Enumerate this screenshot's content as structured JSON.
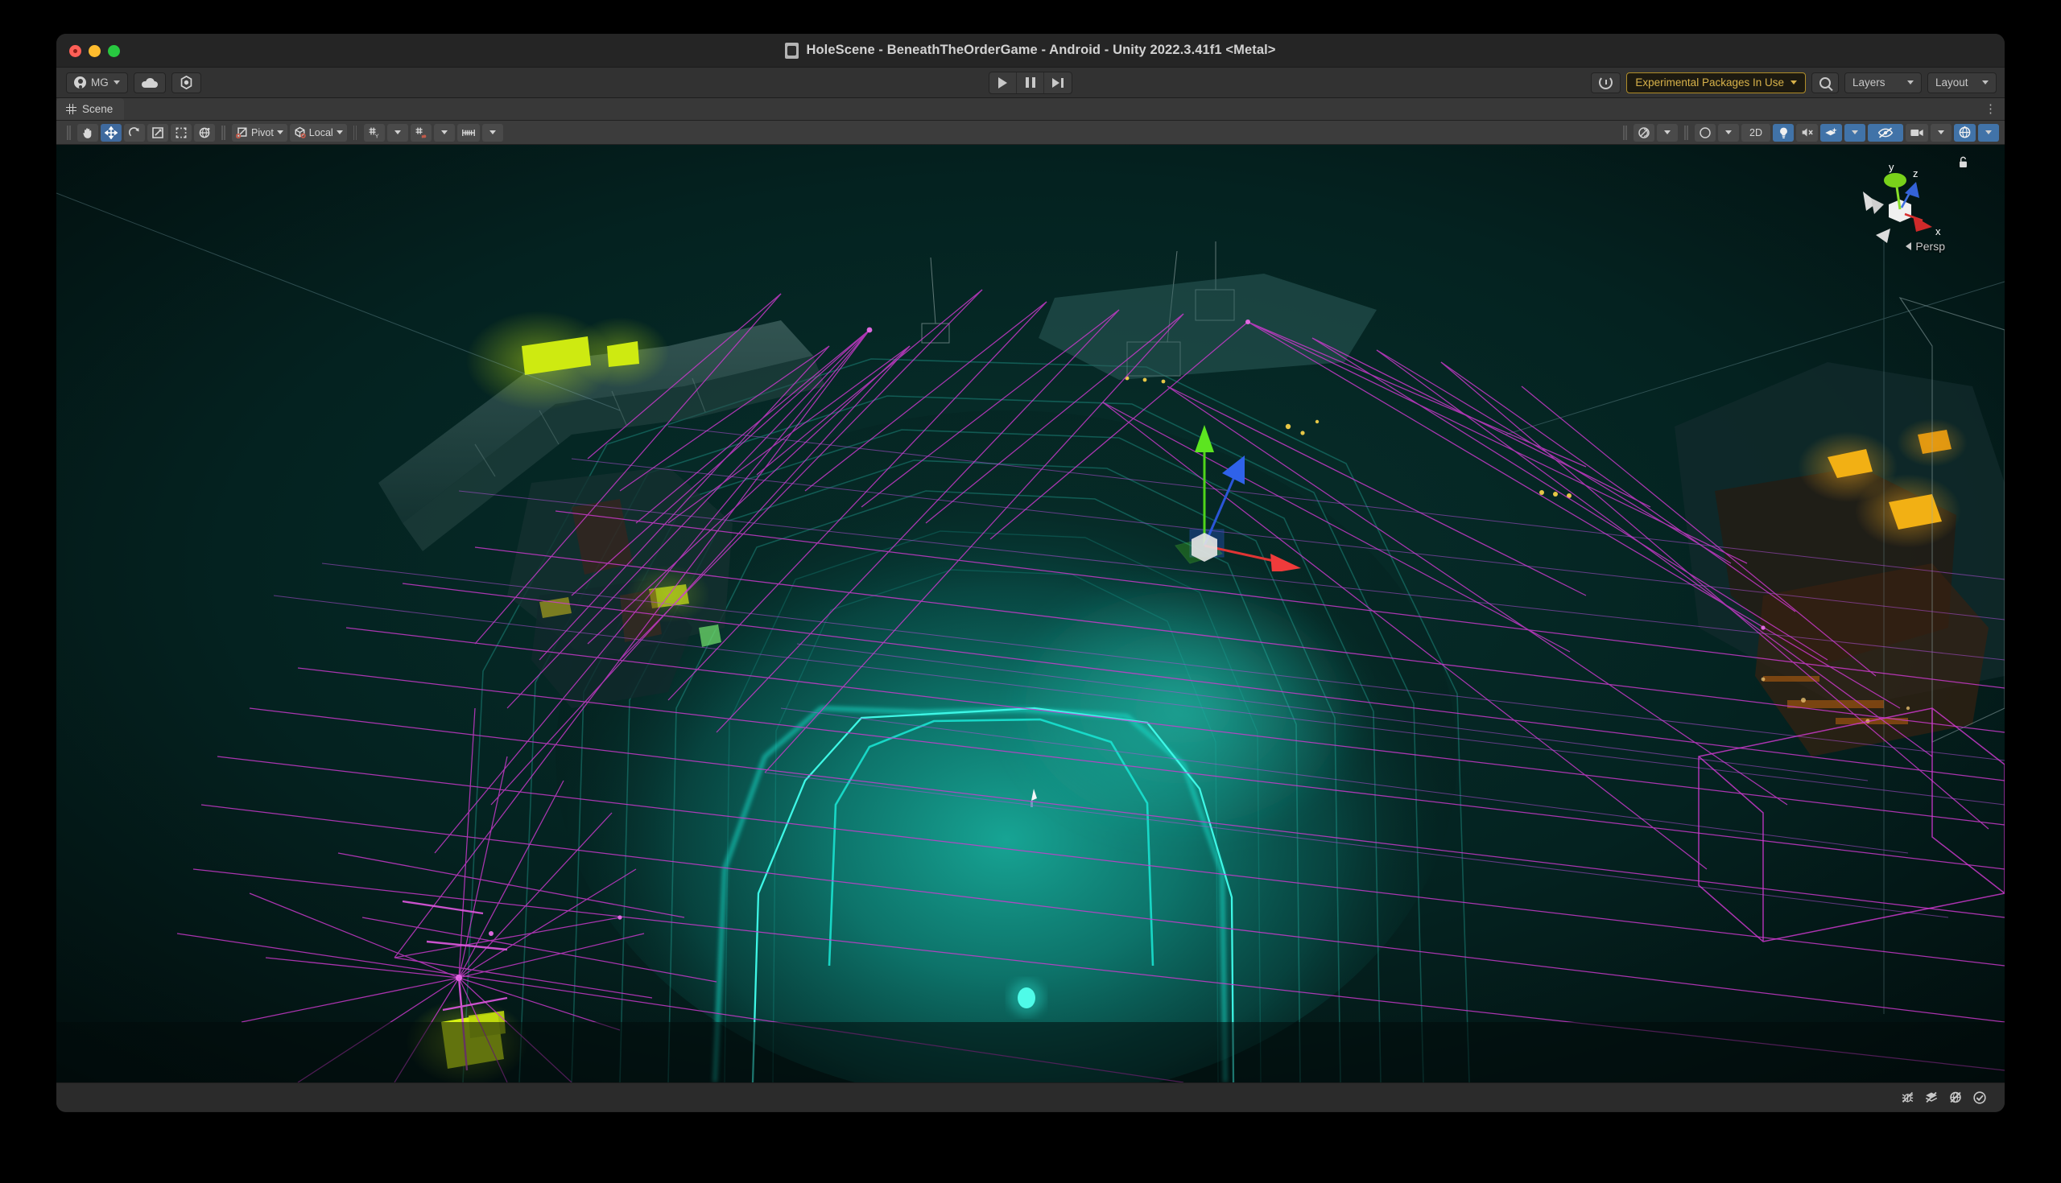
{
  "window": {
    "title": "HoleScene - BeneathTheOrderGame - Android - Unity 2022.3.41f1 <Metal>",
    "title_icon": "unity-scene-file-icon",
    "traffic_lights": [
      "close-button",
      "minimize-button",
      "zoom-button"
    ]
  },
  "main_toolbar": {
    "account_label": "MG",
    "account_icon": "account-icon",
    "cloud_icon": "cloud-icon",
    "settings_icon": "unity-services-gear-icon",
    "play_label": "play-icon",
    "pause_label": "pause-icon",
    "step_label": "step-icon",
    "history_icon": "undo-history-icon",
    "experimental_badge": "Experimental Packages In Use",
    "search_icon": "search-icon",
    "layers_label": "Layers",
    "layout_label": "Layout"
  },
  "tabs": [
    {
      "label": "Scene",
      "icon": "scene-grid-icon",
      "active": true
    }
  ],
  "scene_toolbar": {
    "tools": [
      {
        "name": "hand-tool",
        "tooltip": "Hand Tool",
        "active": false
      },
      {
        "name": "move-tool",
        "tooltip": "Move Tool",
        "active": true
      },
      {
        "name": "rotate-tool",
        "tooltip": "Rotate Tool",
        "active": false
      },
      {
        "name": "scale-tool",
        "tooltip": "Scale Tool",
        "active": false
      },
      {
        "name": "rect-tool",
        "tooltip": "Rect Tool",
        "active": false
      },
      {
        "name": "transform-tool",
        "tooltip": "Transform Tool",
        "active": false
      }
    ],
    "pivot_label": "Pivot",
    "handle_space_label": "Local",
    "grid_snap_icon": "grid-snapping-icon",
    "snap_increment_icon": "snap-increment-icon",
    "ruler_icon": "ruler-icon",
    "right_controls": [
      {
        "name": "draw-mode-dropdown",
        "label": "",
        "active": false
      },
      {
        "name": "shading-mode-dropdown",
        "label": "",
        "active": false
      },
      {
        "name": "2d-toggle",
        "label": "2D",
        "active": false
      },
      {
        "name": "scene-lighting-toggle",
        "label": "",
        "active": true
      },
      {
        "name": "scene-audio-toggle",
        "label": "",
        "active": false
      },
      {
        "name": "scene-fx-dropdown",
        "label": "",
        "active": true
      },
      {
        "name": "scene-visibility-toggle",
        "label": "",
        "active": true
      },
      {
        "name": "camera-settings-dropdown",
        "label": "",
        "active": false
      },
      {
        "name": "gizmos-toggle",
        "label": "",
        "active": true
      }
    ]
  },
  "scene_view": {
    "view_gizmo": {
      "axis_labels": [
        "y",
        "z",
        "x"
      ],
      "projection_label": "Persp",
      "lock_icon": "scene-view-lock-icon",
      "axis_colors": {
        "x": "#d83030",
        "y": "#7fd41a",
        "z": "#2f5fd8"
      }
    },
    "transform_gizmo": {
      "name": "move-gizmo",
      "axis_colors": {
        "x": "#e03434",
        "y": "#4fd51a",
        "z": "#2a56d8"
      }
    },
    "palette": {
      "background": "#04100f",
      "navmesh_links": "#d03ad0",
      "tunnel_wire": "#17e0cf",
      "accent_green": "#cdf21a",
      "accent_amber": "#f5a60a",
      "fog_teal": "#0e6d63"
    }
  },
  "status_bar": {
    "icons": [
      {
        "name": "error-pause-icon",
        "label": "bug-disabled-icon"
      },
      {
        "name": "collab-history-icon",
        "label": "layers-disabled-icon"
      },
      {
        "name": "cloud-sync-icon",
        "label": "cloud-disabled-icon"
      },
      {
        "name": "ready-check-icon",
        "label": "check-circle-icon"
      }
    ]
  }
}
